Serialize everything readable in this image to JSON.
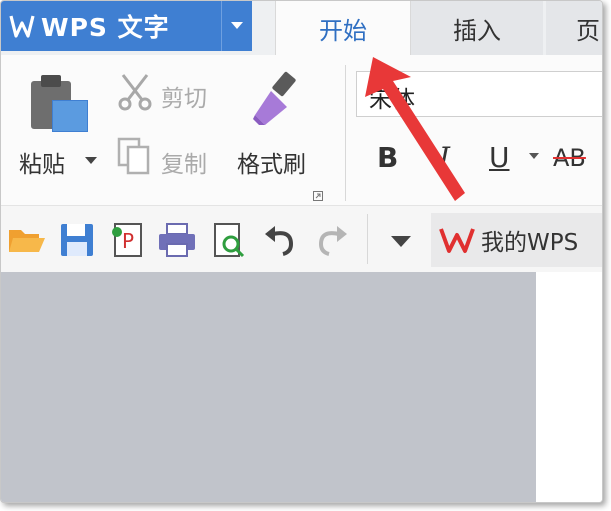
{
  "app": {
    "name": "WPS 文字",
    "brand_color": "#3f7fd2",
    "logo_icon": "wps-w-logo",
    "dropdown_icon": "triangle-down-icon"
  },
  "tabs": [
    {
      "label": "开始",
      "active": true
    },
    {
      "label": "插入",
      "active": false
    },
    {
      "label": "页",
      "active": false
    }
  ],
  "clipboard": {
    "paste_label": "粘贴",
    "cut_label": "剪切",
    "copy_label": "复制",
    "format_painter_label": "格式刷"
  },
  "font": {
    "name": "宋体"
  },
  "format_buttons": {
    "bold": "B",
    "italic": "I",
    "underline": "U",
    "strike": "AB"
  },
  "quick_access": {
    "my_wps_label": "我的WPS",
    "wps_red": "#e03030"
  },
  "annotation": {
    "arrow_color": "#e83838"
  }
}
